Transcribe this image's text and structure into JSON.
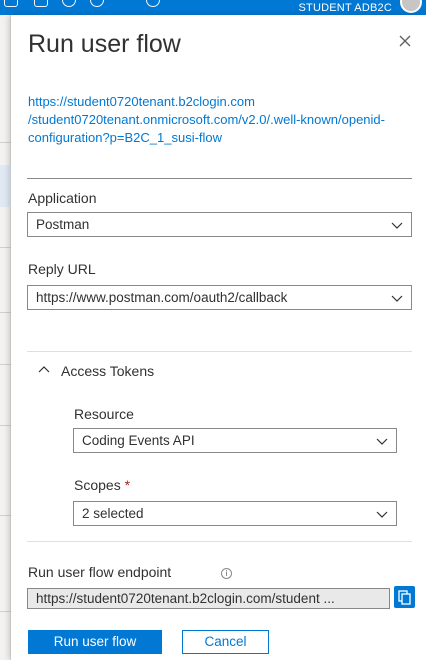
{
  "topbar": {
    "account_name": "STUDENT ADB2C",
    "icons": [
      "terminal-icon",
      "feedback-icon",
      "notification-icon",
      "settings-icon",
      "help-icon",
      "smiley-icon"
    ]
  },
  "panel": {
    "title": "Run user flow",
    "close_icon": "close-icon",
    "metadata_url": "https://student0720tenant.b2clogin.com\n/student0720tenant.onmicrosoft.com/v2.0/.well-known/openid-configuration?p=B2C_1_susi-flow",
    "application": {
      "label": "Application",
      "value": "Postman"
    },
    "reply_url": {
      "label": "Reply URL",
      "value": "https://www.postman.com/oauth2/callback"
    },
    "access_tokens": {
      "toggle_label": "Access Tokens",
      "expanded": true,
      "resource": {
        "label": "Resource",
        "value": "Coding Events API"
      },
      "scopes": {
        "label": "Scopes",
        "required_mark": "*",
        "value": "2 selected"
      }
    },
    "endpoint": {
      "label": "Run user flow endpoint",
      "info_icon": "i",
      "value": "https://student0720tenant.b2clogin.com/student ..."
    },
    "buttons": {
      "run": "Run user flow",
      "cancel": "Cancel"
    }
  },
  "colors": {
    "accent": "#0078d4",
    "required": "#a4262c",
    "text": "#323130"
  }
}
